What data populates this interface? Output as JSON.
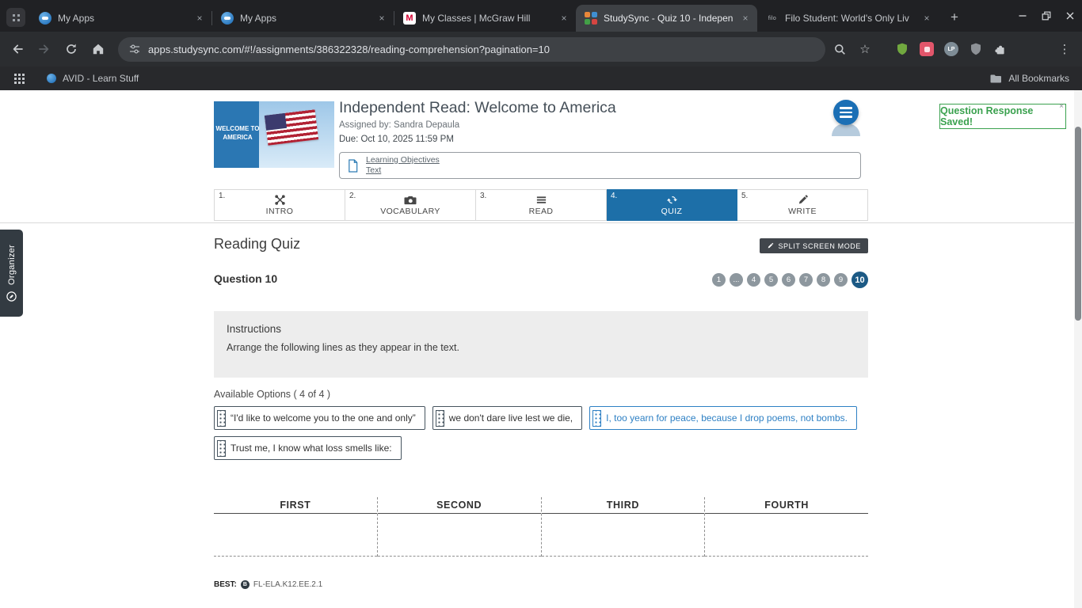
{
  "browser": {
    "tabs": [
      {
        "title": "My Apps"
      },
      {
        "title": "My Apps"
      },
      {
        "title": "My Classes | McGraw Hill"
      },
      {
        "title": "StudySync - Quiz 10 - Indepen"
      },
      {
        "title": "Filo Student: World's Only Liv"
      }
    ],
    "url": "apps.studysync.com/#!/assignments/386322328/reading-comprehension?pagination=10",
    "bookmarks_bar": {
      "bookmark": "AVID - Learn Stuff",
      "all_bookmarks": "All Bookmarks"
    }
  },
  "icons": {
    "tab_close": "×",
    "new_tab": "+",
    "kebab": "⋮",
    "star": "☆",
    "lp_badge": "LP",
    "mcgraw_m": "M",
    "filo_logo": "filo",
    "toast_close": "×",
    "best_glyph": "B"
  },
  "header": {
    "image_line1": "WELCOME TO",
    "image_line2": "AMERICA",
    "title": "Independent Read: Welcome to America",
    "assigned_by": "Assigned by: Sandra Depaula",
    "due": "Due: Oct 10, 2025 11:59 PM",
    "toast": "Question Response Saved!",
    "link_objectives": "Learning Objectives",
    "link_text": "Text"
  },
  "steps": [
    {
      "num": "1.",
      "label": "INTRO"
    },
    {
      "num": "2.",
      "label": "VOCABULARY"
    },
    {
      "num": "3.",
      "label": "READ"
    },
    {
      "num": "4.",
      "label": "QUIZ"
    },
    {
      "num": "5.",
      "label": "WRITE"
    }
  ],
  "organizer": "Organizer",
  "quiz": {
    "heading": "Reading Quiz",
    "split_screen": "SPLIT SCREEN MODE",
    "question": "Question 10",
    "pagination": [
      "1",
      "...",
      "4",
      "5",
      "6",
      "7",
      "8",
      "9",
      "10"
    ],
    "instructions_title": "Instructions",
    "instructions_body": "Arrange the following lines as they appear in the text.",
    "available_options": "Available Options ( 4 of 4 )",
    "options": [
      "“I'd like to welcome you to the one and only”",
      "we don't dare live lest we die,",
      "I, too yearn for peace, because I drop poems, not bombs.",
      "Trust me, I know what loss smells like:"
    ],
    "columns": [
      "FIRST",
      "SECOND",
      "THIRD",
      "FOURTH"
    ],
    "best_label": "BEST:",
    "best_code": "FL-ELA.K12.EE.2.1"
  },
  "colors": {
    "accent_blue": "#1d6fa8",
    "pagination_active_blue": "#1c5a85",
    "success_green": "#3aa14e",
    "option_blue": "#2e80c4"
  }
}
